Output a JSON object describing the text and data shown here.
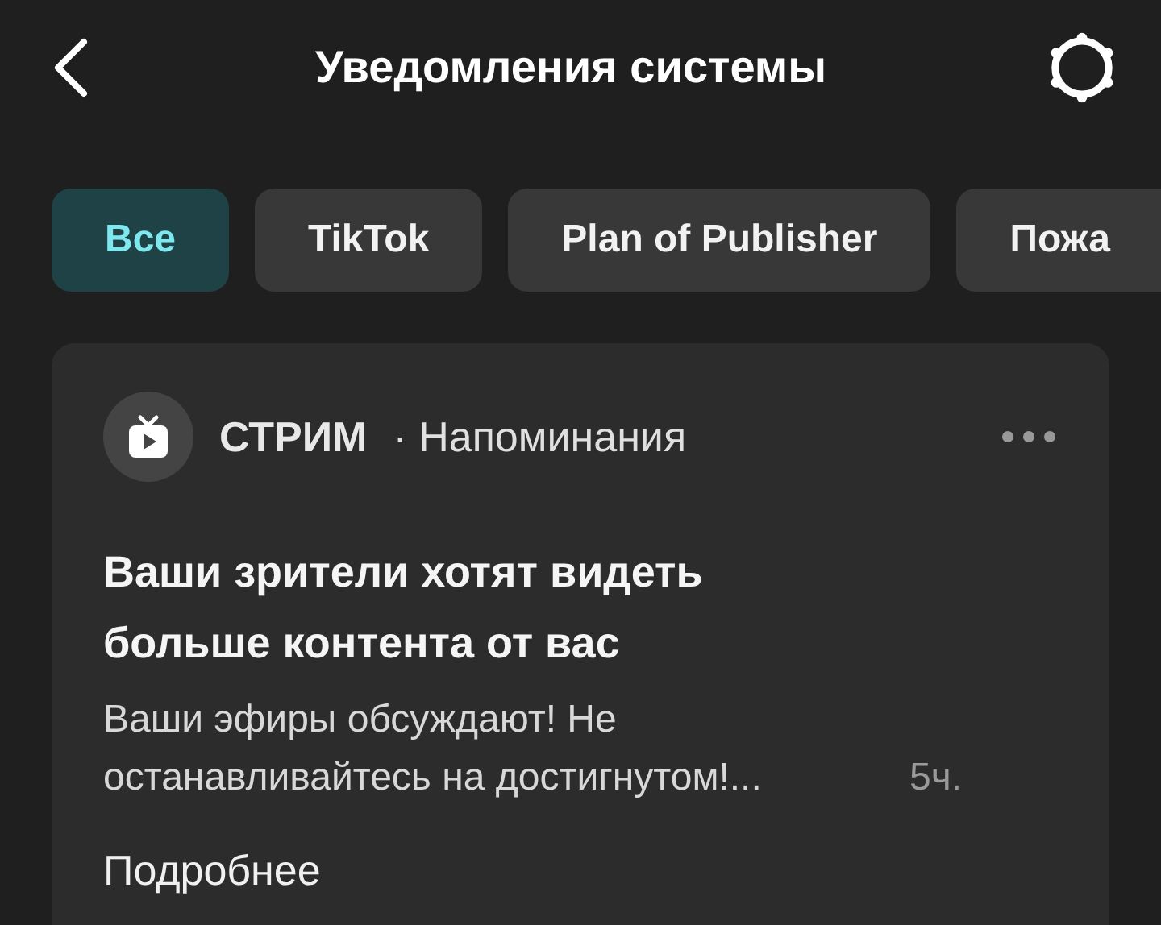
{
  "header": {
    "title": "Уведомления системы"
  },
  "filters": [
    {
      "label": "Все",
      "selected": true
    },
    {
      "label": "TikTok",
      "selected": false
    },
    {
      "label": "Plan of Publisher",
      "selected": false
    },
    {
      "label": "Пожа",
      "selected": false
    }
  ],
  "notification": {
    "source": "СТРИМ",
    "category": "· Напоминания",
    "title": "Ваши зрители хотят видеть больше контента от вас",
    "body": "Ваши эфиры обсуждают! Не останавливайтесь на достигнутом!...",
    "time": "5ч.",
    "link": "Подробнее"
  }
}
